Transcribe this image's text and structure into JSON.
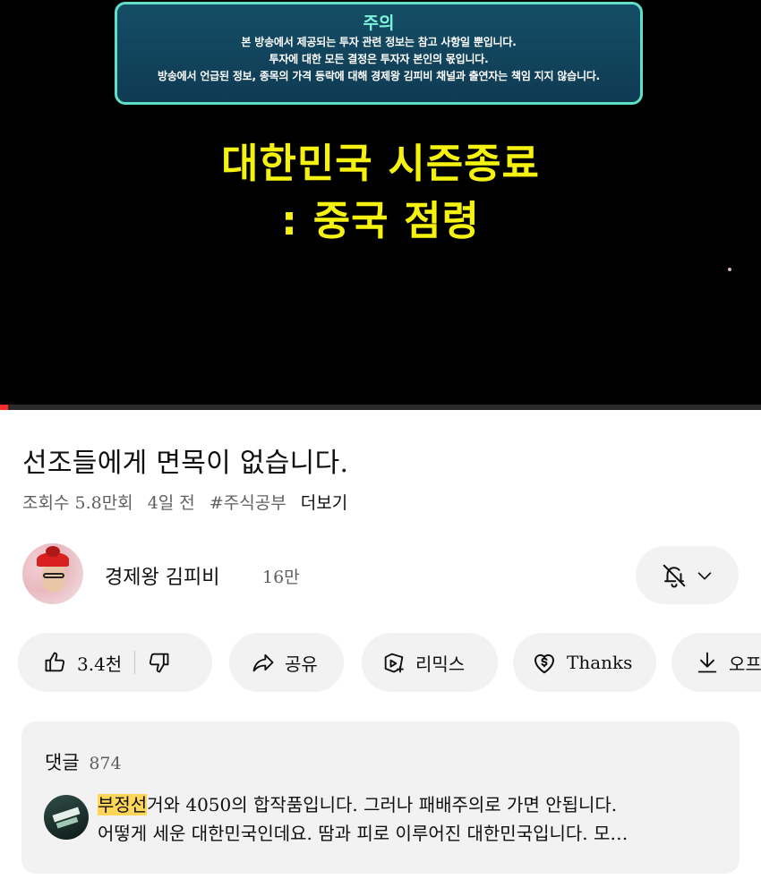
{
  "player": {
    "notice": {
      "title": "주의",
      "lines": [
        "본 방송에서 제공되는 투자 관련 정보는 참고 사항일 뿐입니다.",
        "투자에 대한 모든 결정은 투자자 본인의 몫입니다.",
        "방송에서 언급된 정보, 종목의 가격 등락에 대해 경제왕 김피비 채널과 출연자는 책임 지지 않습니다."
      ]
    },
    "headline": {
      "line1": "대한민국 시즌종료",
      "line2": ": 중국 점령"
    },
    "progress_fraction": 0.01
  },
  "video": {
    "title": "선조들에게 면목이 없습니다.",
    "views": "조회수 5.8만회",
    "age": "4일 전",
    "hashtag": "#주식공부",
    "more": "더보기"
  },
  "channel": {
    "name": "경제왕 김피비",
    "subscribers": "16만"
  },
  "actions": {
    "likes": "3.4천",
    "share": "공유",
    "remix": "리믹스",
    "thanks": "Thanks",
    "download": "오프"
  },
  "comments": {
    "label": "댓글",
    "count": "874",
    "top": {
      "highlight": "부정선",
      "line1_rest": "거와 4050의 합작품입니다. 그러나 패배주의로 가면 안됩니다.",
      "line2": "어떻게 세운 대한민국인데요. 땀과 피로 이루어진 대한민국입니다. 모…"
    }
  },
  "colors": {
    "notice_border": "#5fe0c6",
    "headline": "#f4f20e",
    "progress": "#ff2b2b",
    "chip_bg": "#f2f2f2",
    "highlight": "#ffd659"
  }
}
